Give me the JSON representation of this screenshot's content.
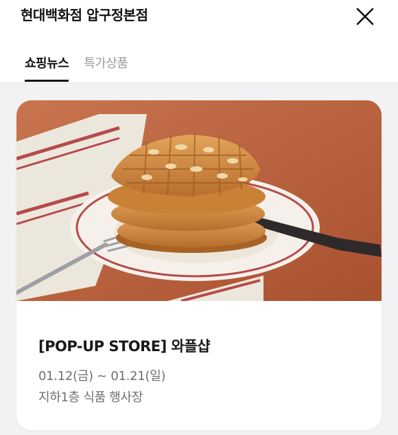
{
  "header": {
    "title": "현대백화점 압구정본점",
    "close_icon": "close-icon"
  },
  "tabs": [
    {
      "label": "쇼핑뉴스",
      "active": true
    },
    {
      "label": "특가상품",
      "active": false
    }
  ],
  "event_card": {
    "image_icon": "waffle-photo",
    "title": "[POP-UP STORE] 와플샵",
    "date_range": "01.12(금) ~ 01.21(일)",
    "location": "지하1층 식품 행사장"
  }
}
